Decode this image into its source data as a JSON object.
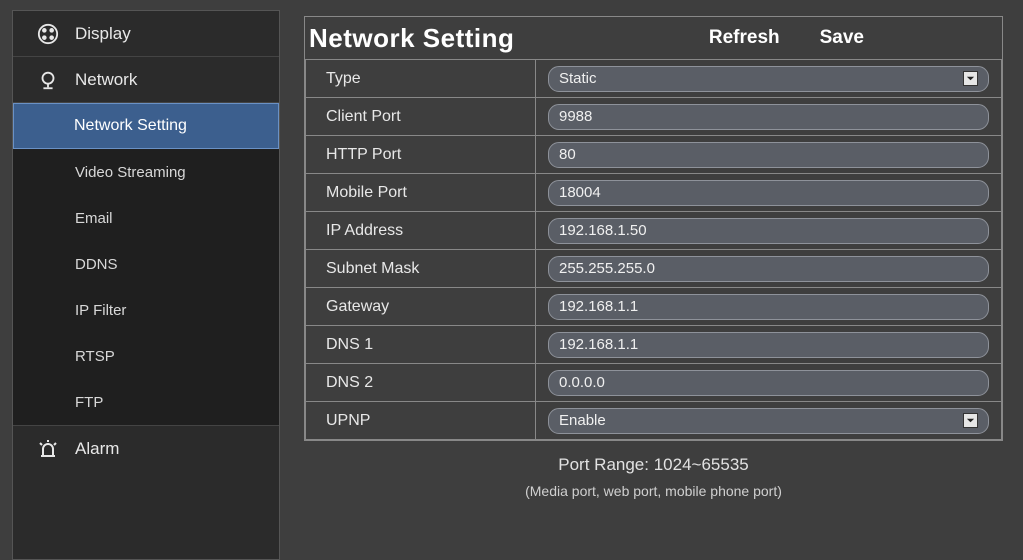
{
  "sidebar": {
    "display": "Display",
    "network": "Network",
    "alarm": "Alarm",
    "sub": {
      "network_setting": "Network Setting",
      "video_streaming": "Video Streaming",
      "email": "Email",
      "ddns": "DDNS",
      "ip_filter": "IP Filter",
      "rtsp": "RTSP",
      "ftp": "FTP"
    }
  },
  "page": {
    "title": "Network Setting",
    "refresh": "Refresh",
    "save": "Save"
  },
  "fields": {
    "type": {
      "label": "Type",
      "value": "Static"
    },
    "client_port": {
      "label": "Client Port",
      "value": "9988"
    },
    "http_port": {
      "label": "HTTP Port",
      "value": "80"
    },
    "mobile_port": {
      "label": "Mobile Port",
      "value": "18004"
    },
    "ip_address": {
      "label": "IP Address",
      "value": "192.168.1.50"
    },
    "subnet_mask": {
      "label": "Subnet Mask",
      "value": "255.255.255.0"
    },
    "gateway": {
      "label": "Gateway",
      "value": "192.168.1.1"
    },
    "dns1": {
      "label": "DNS 1",
      "value": "192.168.1.1"
    },
    "dns2": {
      "label": "DNS 2",
      "value": "0.0.0.0"
    },
    "upnp": {
      "label": "UPNP",
      "value": "Enable"
    }
  },
  "footer": {
    "range": "Port Range: 1024~65535",
    "sub": "(Media port, web port, mobile phone port)"
  }
}
